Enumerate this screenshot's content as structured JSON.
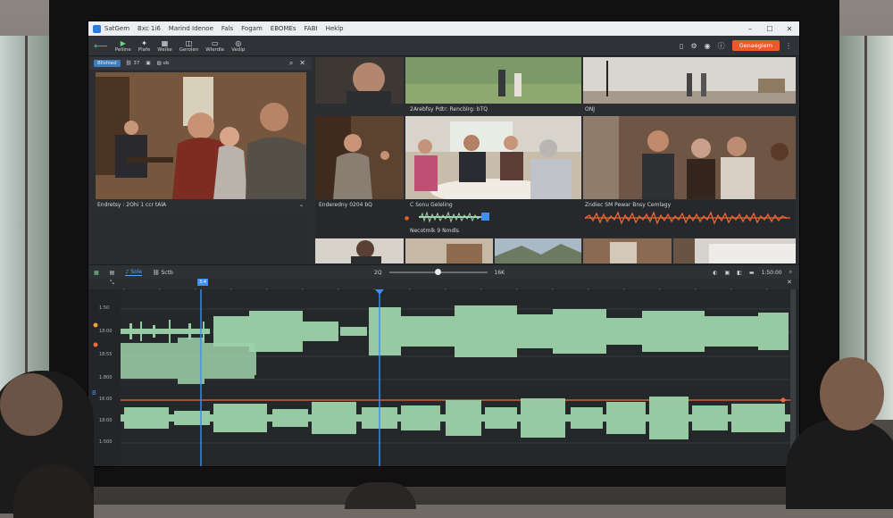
{
  "menubar": {
    "items": [
      "SatGem",
      "Bxc 1i6",
      "Marind Idenoe",
      "Fals",
      "Fogam",
      "EBOMEs",
      "FABI",
      "Heklp"
    ]
  },
  "toolbar": {
    "items": [
      {
        "label": "Pelline",
        "icon": "play-icon"
      },
      {
        "label": "Plafe",
        "icon": "sparkle-icon"
      },
      {
        "label": "Welke",
        "icon": "grid-icon"
      },
      {
        "label": "Gerolen",
        "icon": "layers-icon"
      },
      {
        "label": "Wlerdle",
        "icon": "window-icon"
      },
      {
        "label": "Vedip",
        "icon": "video-icon"
      }
    ],
    "export_label": "Genaegiem"
  },
  "viewer": {
    "chip": "Bllshied",
    "tabs": [
      "37",
      "",
      "ob"
    ],
    "caption": "Endretsy : 2Ohi 1 ccr tAlA"
  },
  "grid": {
    "captions": [
      "2Arebfsy Pdtr: Rencblrg: bTQ",
      "ONJ",
      "Enderedny 0204 bQ",
      "Zndiec SM Pewar Bnsy Cemlagy",
      "C Sonu Geleling",
      "Necotmlk 9 Nmdls"
    ]
  },
  "timeline": {
    "tabs": [
      "Sole",
      "Sctb"
    ],
    "counter_left": "2Q",
    "counter_right": "16K",
    "zoom_level": 0.5,
    "timecode_right": "1:50:00",
    "ruler_marker": "3:4",
    "track_labels": [
      "1:50",
      "18:00",
      "18:55",
      "1:800",
      "16:00",
      "18:00",
      "1:500"
    ]
  },
  "colors": {
    "accent": "#3e8ff0",
    "export": "#ea5b2b",
    "wave_green": "#9ed2aa",
    "wave_orange": "#f26a35"
  }
}
